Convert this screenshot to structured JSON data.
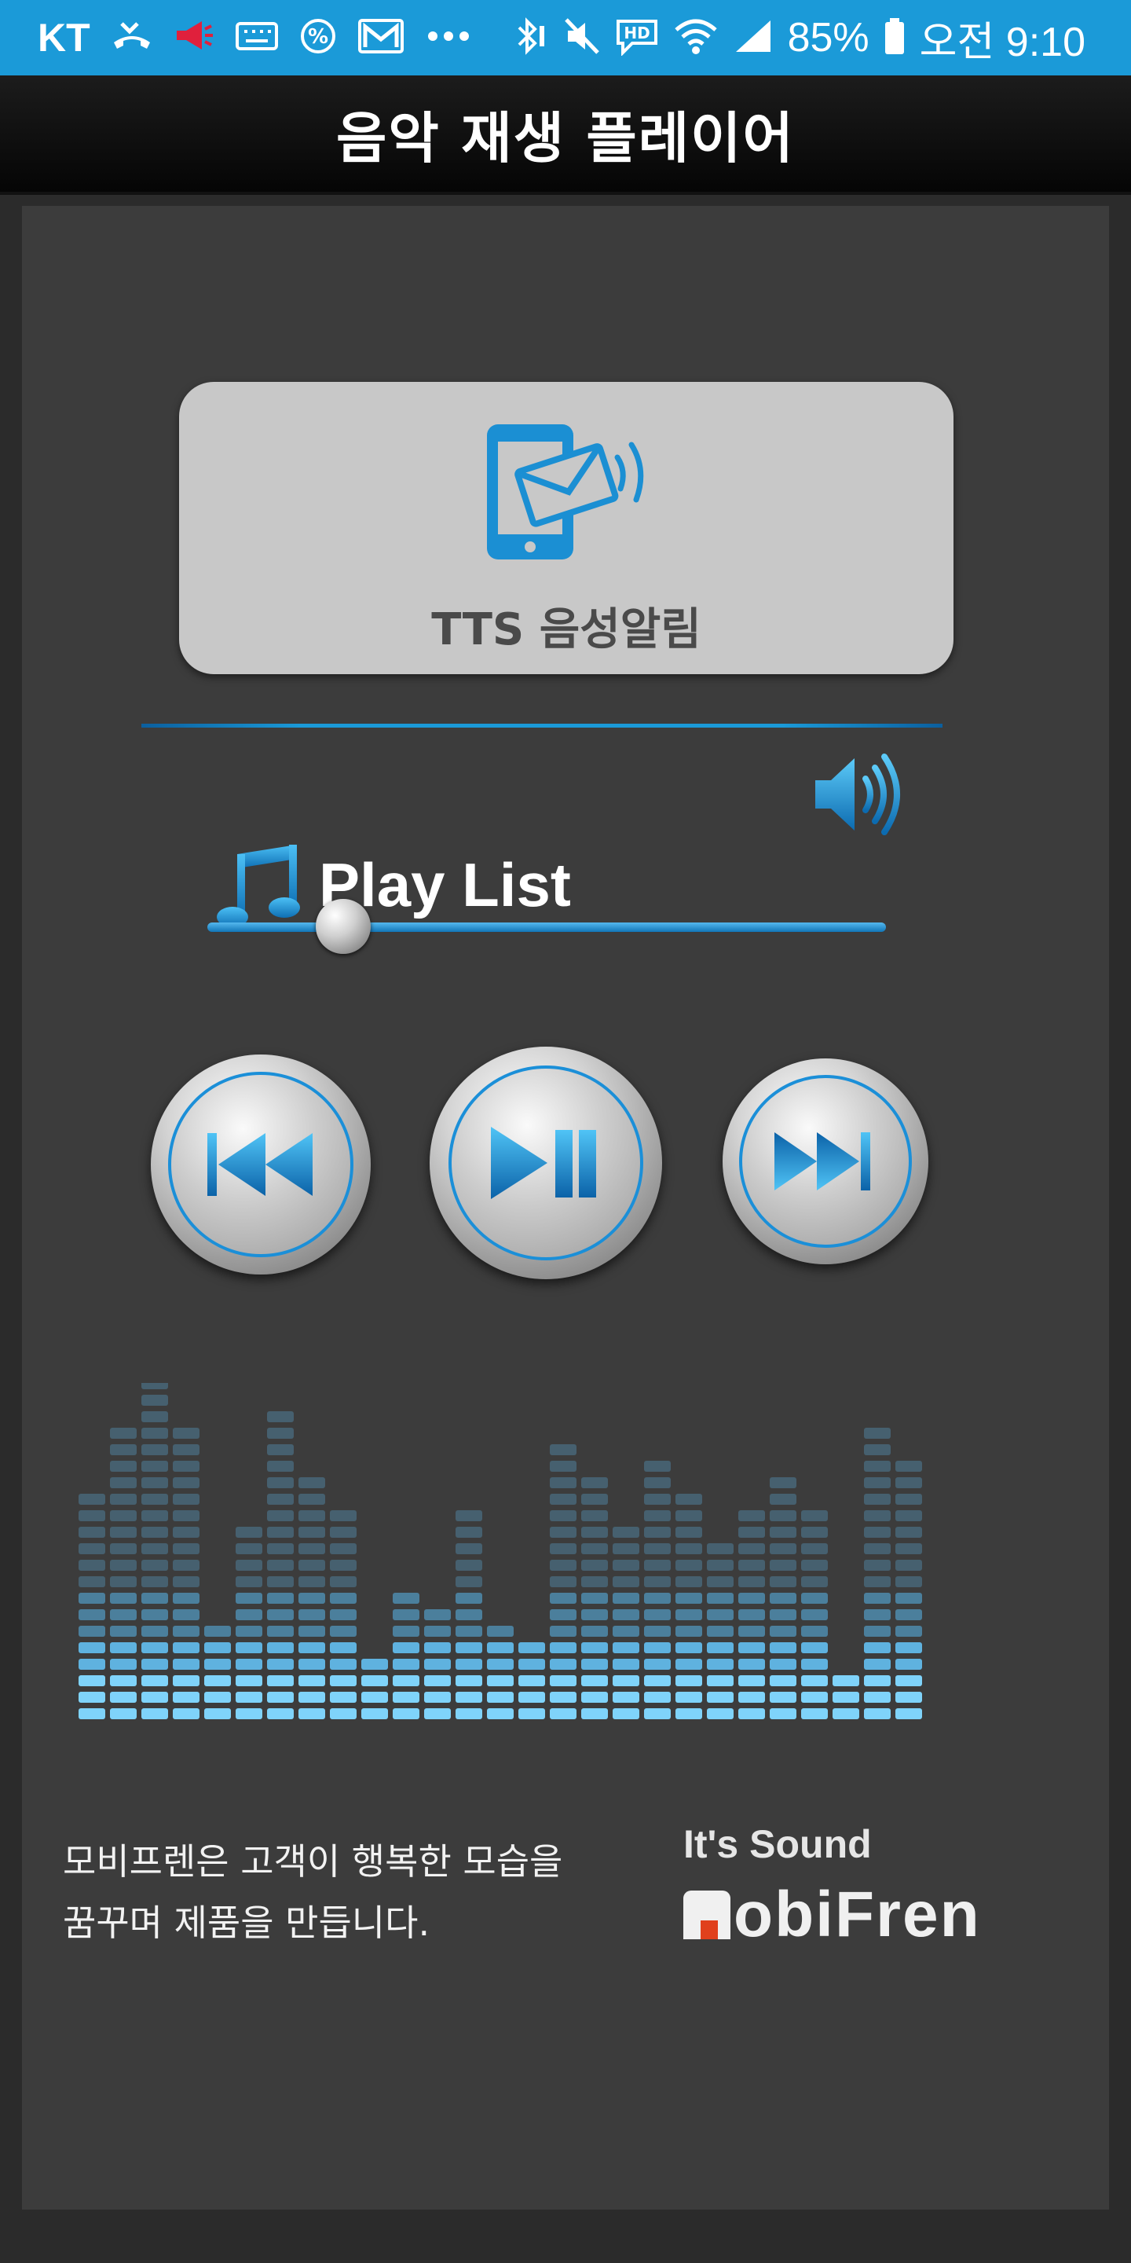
{
  "status_bar": {
    "carrier": "KT",
    "battery": "85%",
    "time": "오전 9:10",
    "left_icons": [
      "missed-call-icon",
      "megaphone-icon",
      "keyboard-icon",
      "percent-icon",
      "mail-icon",
      "more-dots-icon"
    ],
    "right_icons": [
      "bluetooth-icon",
      "mute-icon",
      "hd-icon",
      "wifi-icon",
      "signal-icon",
      "battery-icon"
    ]
  },
  "header": {
    "title": "음악 재생 플레이어"
  },
  "tts": {
    "label": "TTS 음성알림",
    "icon": "phone-message-icon"
  },
  "playlist": {
    "title": "Play List",
    "icon": "music-note-icon"
  },
  "volume": {
    "icon": "speaker-icon",
    "level": 0.2
  },
  "controls": {
    "prev": "previous-track-icon",
    "play_pause": "play-pause-icon",
    "next": "next-track-icon"
  },
  "equalizer": {
    "levels": [
      14,
      18,
      21,
      18,
      6,
      12,
      19,
      15,
      13,
      4,
      8,
      7,
      13,
      6,
      5,
      17,
      15,
      12,
      16,
      14,
      11,
      13,
      15,
      13,
      3,
      18,
      16
    ]
  },
  "footer": {
    "line1": "모비프렌은 고객이 행복한 모습을",
    "line2": "꿈꾸며 제품을 만듭니다.",
    "brand_tag": "It's Sound",
    "brand_name": "obiFren"
  },
  "colors": {
    "accent": "#1b9ad8",
    "panel": "#3c3c3c",
    "tts_button": "#c8c8c8",
    "brand_red": "#e0401c"
  }
}
